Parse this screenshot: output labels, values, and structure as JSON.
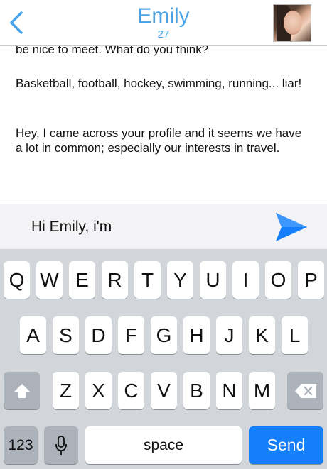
{
  "header": {
    "title": "Emily",
    "subtitle": "27"
  },
  "messages": [
    {
      "text": "be nice to meet. What do you think?"
    },
    {
      "text": "Basketball, football, hockey, swimming, running... liar!"
    },
    {
      "text": "Hey, I came across your profile and it seems we have a lot in common; especially our interests in travel."
    }
  ],
  "composer": {
    "value": "Hi Emily, i'm"
  },
  "keyboard": {
    "row1": [
      "Q",
      "W",
      "E",
      "R",
      "T",
      "Y",
      "U",
      "I",
      "O",
      "P"
    ],
    "row2": [
      "A",
      "S",
      "D",
      "F",
      "G",
      "H",
      "J",
      "K",
      "L"
    ],
    "row3": [
      "Z",
      "X",
      "C",
      "V",
      "B",
      "N",
      "M"
    ],
    "numbers_label": "123",
    "space_label": "space",
    "send_label": "Send"
  },
  "colors": {
    "accent": "#4aa3e6",
    "send_key": "#157efb",
    "keyboard_bg": "#d2d5da"
  }
}
